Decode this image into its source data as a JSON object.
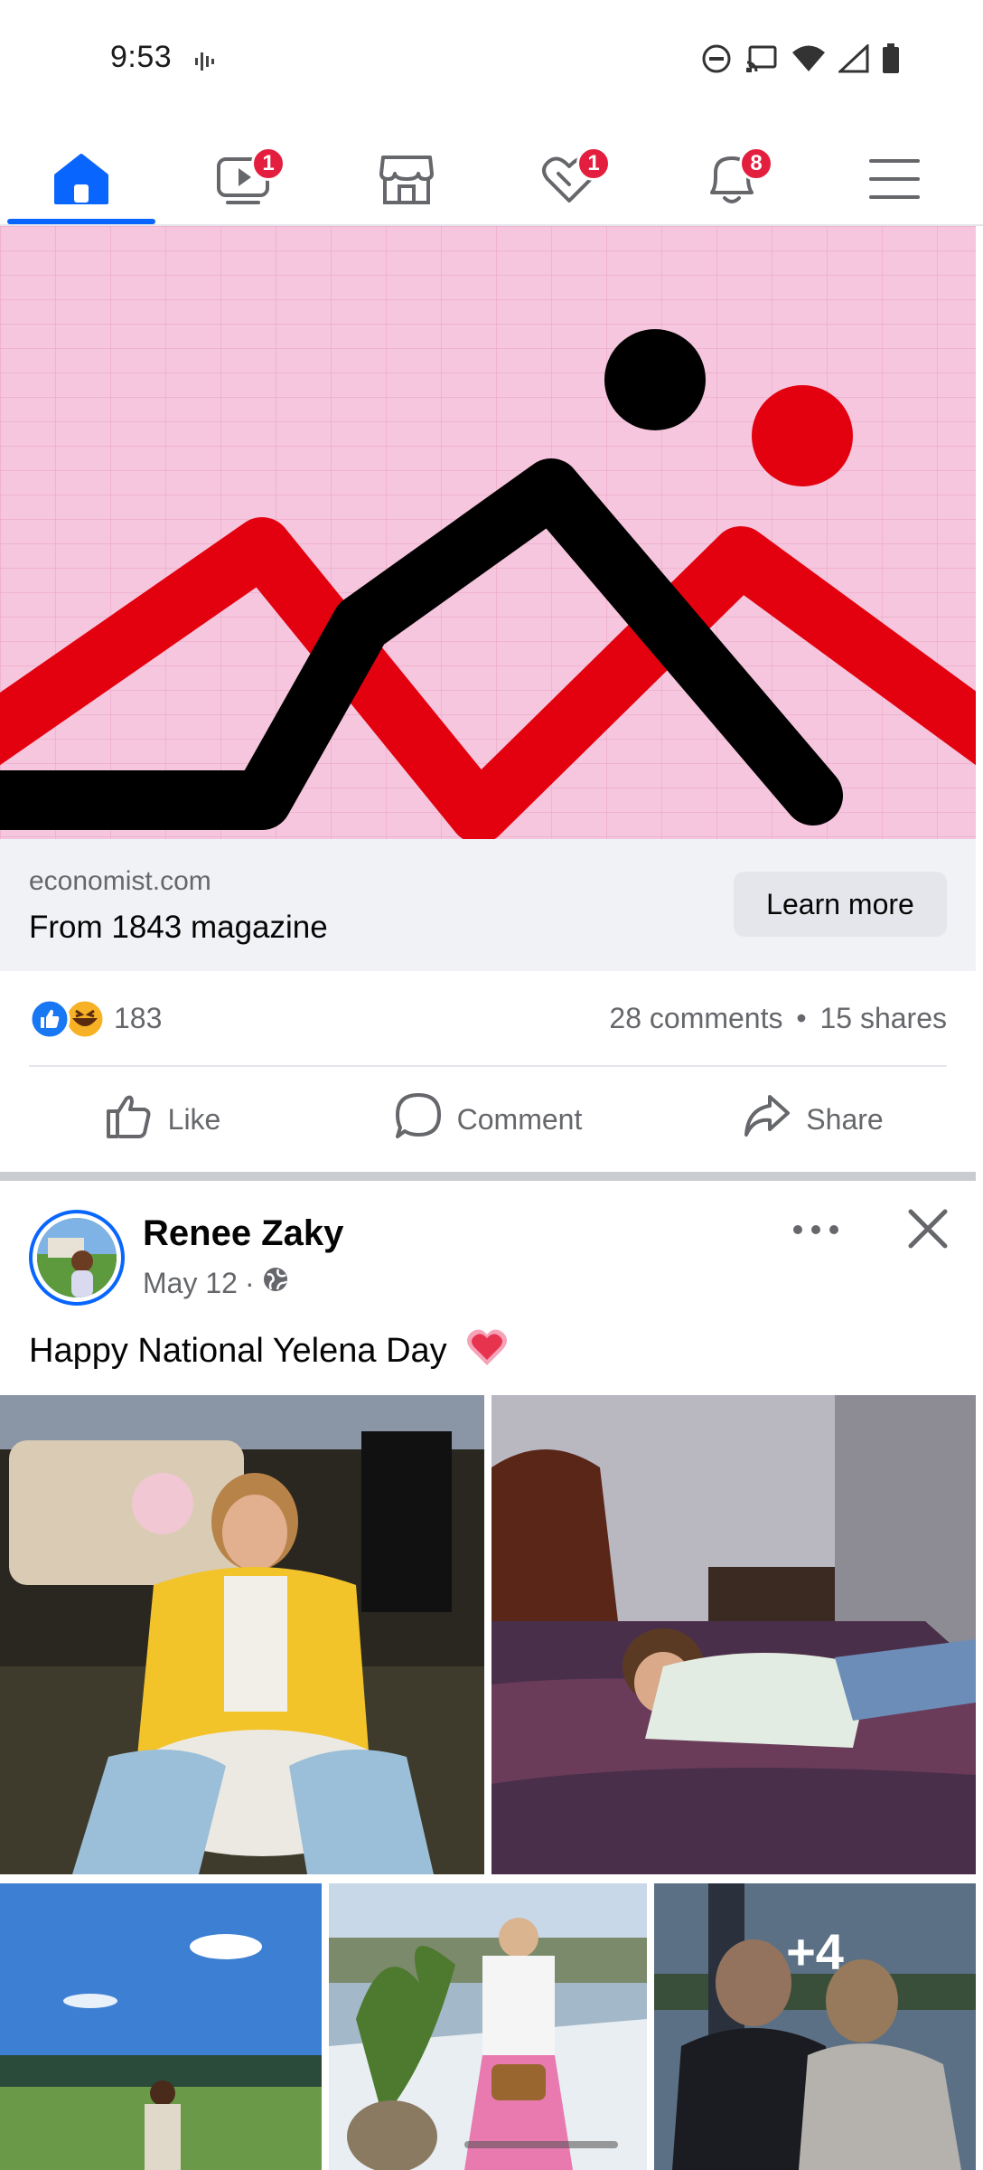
{
  "status_bar": {
    "time": "9:53",
    "icons": [
      "voice-wave-icon",
      "do-not-disturb-icon",
      "cast-icon",
      "wifi-icon",
      "signal-icon",
      "battery-icon"
    ]
  },
  "nav": {
    "items": [
      {
        "icon": "home-icon",
        "badge": "",
        "active": true
      },
      {
        "icon": "video-icon",
        "badge": "1"
      },
      {
        "icon": "marketplace-icon",
        "badge": ""
      },
      {
        "icon": "dating-icon",
        "badge": "1"
      },
      {
        "icon": "bell-icon",
        "badge": "8"
      },
      {
        "icon": "menu-icon",
        "badge": ""
      }
    ]
  },
  "ad": {
    "domain": "economist.com",
    "title": "From 1843 magazine",
    "cta": "Learn more"
  },
  "reactions": {
    "count": "183",
    "comments": "28 comments",
    "separator": "•",
    "shares": "15 shares",
    "icons": [
      "like-reaction-icon",
      "haha-reaction-icon"
    ]
  },
  "actions": {
    "like": "Like",
    "comment": "Comment",
    "share": "Share"
  },
  "post": {
    "author": "Renee Zaky",
    "date": "May 12",
    "dot": "·",
    "text": "Happy National Yelena Day",
    "more_photos": "+4"
  },
  "colors": {
    "accent": "#0866ff",
    "badge": "#e41e3f",
    "ad_pink": "#f5c6dd",
    "ad_red": "#e3000f"
  }
}
